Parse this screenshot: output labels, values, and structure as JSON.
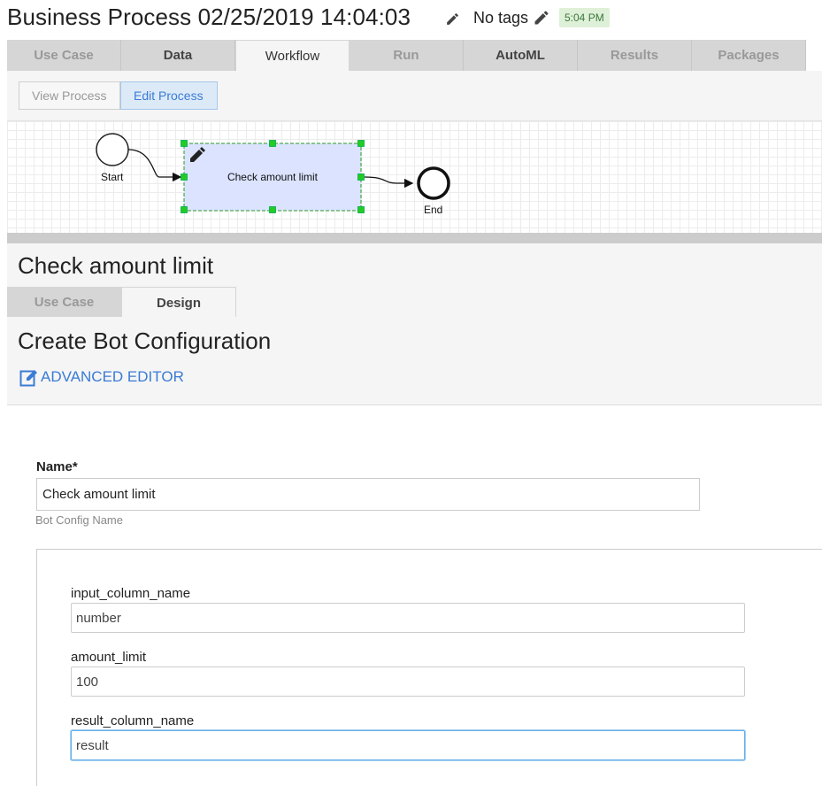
{
  "header": {
    "title": "Business Process 02/25/2019 14:04:03",
    "tags_label": "No tags",
    "time_badge": "5:04 PM"
  },
  "top_tabs": [
    {
      "label": "Use Case",
      "state": "disabled"
    },
    {
      "label": "Data",
      "state": "enabled"
    },
    {
      "label": "Workflow",
      "state": "active"
    },
    {
      "label": "Run",
      "state": "disabled"
    },
    {
      "label": "AutoML",
      "state": "enabled"
    },
    {
      "label": "Results",
      "state": "disabled"
    },
    {
      "label": "Packages",
      "state": "disabled"
    }
  ],
  "process_buttons": {
    "view": "View Process",
    "edit": "Edit Process"
  },
  "diagram": {
    "start_label": "Start",
    "task_label": "Check amount limit",
    "end_label": "End"
  },
  "lower": {
    "section_title": "Check amount limit",
    "sub_tabs": [
      {
        "label": "Use Case",
        "state": "inactive"
      },
      {
        "label": "Design",
        "state": "active"
      }
    ],
    "config_title": "Create Bot Configuration",
    "advanced_editor": "ADVANCED EDITOR"
  },
  "form": {
    "name_label": "Name*",
    "name_value": "Check amount limit",
    "name_help": "Bot Config Name",
    "params": [
      {
        "label": "input_column_name",
        "value": "number"
      },
      {
        "label": "amount_limit",
        "value": "100"
      },
      {
        "label": "result_column_name",
        "value": "result"
      }
    ]
  },
  "colors": {
    "accent": "#3a7bd5",
    "badge_bg": "#dff0d8",
    "task_fill": "#dbe3ff",
    "handle": "#22cc22"
  }
}
